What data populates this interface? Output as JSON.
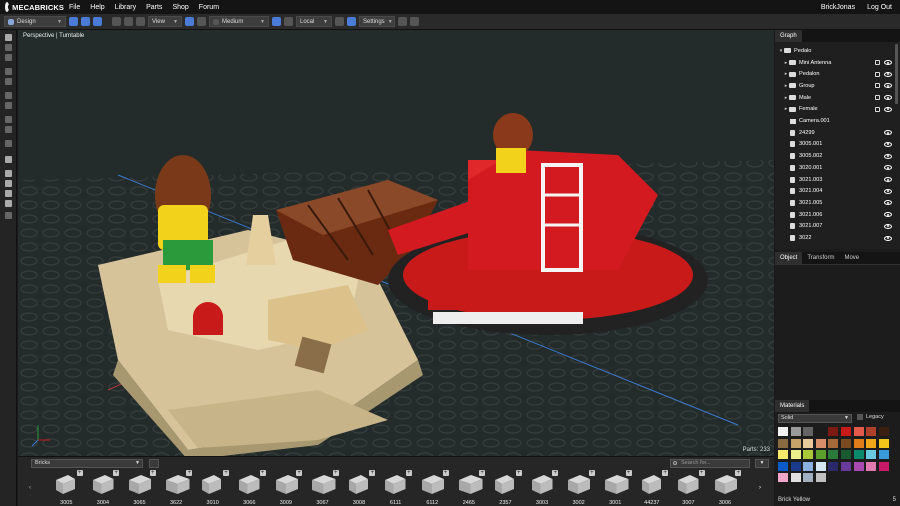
{
  "app": {
    "logo_text": "MECABRICKS",
    "menu": [
      "File",
      "Help",
      "Library",
      "Parts",
      "Shop",
      "Forum"
    ],
    "user": "BrickJonas",
    "logout": "Log Out"
  },
  "toolbar": {
    "mode": "Design",
    "view": "View",
    "quality": "Medium",
    "space": "Local",
    "settings": "Settings"
  },
  "viewport": {
    "label": "Perspective | Turntable",
    "parts_count": "Parts: 233"
  },
  "graph": {
    "tab": "Graph",
    "items": [
      {
        "label": "Pedalo",
        "type": "folder",
        "expander": "▾",
        "indent": 0,
        "lock": false,
        "eye": false
      },
      {
        "label": "Mini Antenna",
        "type": "folder",
        "expander": "▸",
        "indent": 1,
        "lock": true,
        "eye": true
      },
      {
        "label": "Pedalon",
        "type": "folder",
        "expander": "▸",
        "indent": 1,
        "lock": true,
        "eye": true
      },
      {
        "label": "Group",
        "type": "folder",
        "expander": "▸",
        "indent": 1,
        "lock": true,
        "eye": true
      },
      {
        "label": "Male",
        "type": "folder",
        "expander": "▸",
        "indent": 1,
        "lock": true,
        "eye": true
      },
      {
        "label": "Female",
        "type": "folder",
        "expander": "▸",
        "indent": 1,
        "lock": true,
        "eye": true
      },
      {
        "label": "Camera.001",
        "type": "camera",
        "expander": "",
        "indent": 1,
        "lock": false,
        "eye": false
      },
      {
        "label": "24299",
        "type": "brick",
        "expander": "",
        "indent": 1,
        "lock": false,
        "eye": true
      },
      {
        "label": "3005.001",
        "type": "brick",
        "expander": "",
        "indent": 1,
        "lock": false,
        "eye": true
      },
      {
        "label": "3005.002",
        "type": "brick",
        "expander": "",
        "indent": 1,
        "lock": false,
        "eye": true
      },
      {
        "label": "3020.001",
        "type": "brick",
        "expander": "",
        "indent": 1,
        "lock": false,
        "eye": true
      },
      {
        "label": "3021.003",
        "type": "brick",
        "expander": "",
        "indent": 1,
        "lock": false,
        "eye": true
      },
      {
        "label": "3021.004",
        "type": "brick",
        "expander": "",
        "indent": 1,
        "lock": false,
        "eye": true
      },
      {
        "label": "3021.005",
        "type": "brick",
        "expander": "",
        "indent": 1,
        "lock": false,
        "eye": true
      },
      {
        "label": "3021.006",
        "type": "brick",
        "expander": "",
        "indent": 1,
        "lock": false,
        "eye": true
      },
      {
        "label": "3021.007",
        "type": "brick",
        "expander": "",
        "indent": 1,
        "lock": false,
        "eye": true
      },
      {
        "label": "3022",
        "type": "brick",
        "expander": "",
        "indent": 1,
        "lock": false,
        "eye": true
      }
    ]
  },
  "panels": {
    "tabs": [
      "Object",
      "Transform",
      "Move"
    ]
  },
  "materials": {
    "tab": "Materials",
    "type": "Solid",
    "legacy_label": "Legacy",
    "selected_name": "Brick Yellow",
    "selected_count": "5",
    "colors": [
      "#f2f2f2",
      "#9a9a9a",
      "#646464",
      "#1b1b1b",
      "#7a1a12",
      "#c91a1a",
      "#e35a4a",
      "#b0402a",
      "#3a1e10",
      "#8a6a40",
      "#c7a46a",
      "#e9c89a",
      "#d9906a",
      "#a5693a",
      "#7a4a20",
      "#e07d1a",
      "#f2a61a",
      "#f2c51a",
      "#f7e96a",
      "#e9f08a",
      "#a9c93a",
      "#5aa02a",
      "#2a7a3a",
      "#1a5a30",
      "#0a8a6a",
      "#6ac9e0",
      "#3a9ad9",
      "#0a5ac9",
      "#1a3a8a",
      "#8ab0e0",
      "#d3e6f2",
      "#2a2a6a",
      "#6a3a9a",
      "#a94ab0",
      "#e07ab0",
      "#c91a6a",
      "#f2a6c9",
      "#e0e0e0",
      "#a0b0c0",
      "#c0c0c0"
    ]
  },
  "bricks_bar": {
    "category": "Bricks",
    "search_placeholder": "Search for...",
    "filter": "▼",
    "prev": "‹",
    "next": "›",
    "items": [
      "3005",
      "3004",
      "3065",
      "3622",
      "3010",
      "3066",
      "3009",
      "3067",
      "3008",
      "6111",
      "6112",
      "2465",
      "2357",
      "3003",
      "3002",
      "3001",
      "44237",
      "3007",
      "3006"
    ]
  }
}
